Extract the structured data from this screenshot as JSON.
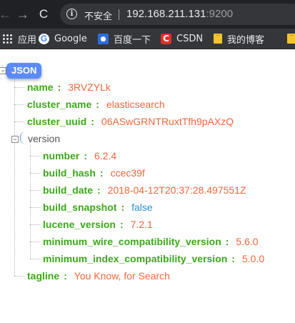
{
  "browser": {
    "security_label": "不安全",
    "url_host": "192.168.211.131",
    "url_port": ":9200"
  },
  "bookmarks": [
    {
      "label": "应用",
      "icon": "apps-icon"
    },
    {
      "label": "Google",
      "icon": "google-icon"
    },
    {
      "label": "百度一下",
      "icon": "baidu-icon"
    },
    {
      "label": "CSDN",
      "icon": "csdn-icon"
    },
    {
      "label": "我的博客",
      "icon": "folder-icon"
    }
  ],
  "icons": {
    "back": "←",
    "forward": "→",
    "reload": "C",
    "info": "i",
    "google_glyph": "G",
    "csdn_glyph": "C",
    "toggle_minus": "−"
  },
  "json_view": {
    "root_label": "JSON",
    "name": {
      "key": "name",
      "value": "3RVZYLk"
    },
    "cluster_name": {
      "key": "cluster_name",
      "value": "elasticsearch"
    },
    "cluster_uuid": {
      "key": "cluster_uuid",
      "value": "06ASwGRNTRuxtTfh9pAXzQ"
    },
    "version": {
      "key": "version",
      "number": {
        "key": "number",
        "value": "6.2.4"
      },
      "build_hash": {
        "key": "build_hash",
        "value": "ccec39f"
      },
      "build_date": {
        "key": "build_date",
        "value": "2018-04-12T20:37:28.497551Z"
      },
      "build_snapshot": {
        "key": "build_snapshot",
        "value": "false"
      },
      "lucene_version": {
        "key": "lucene_version",
        "value": "7.2.1"
      },
      "minimum_wire_compatibility_version": {
        "key": "minimum_wire_compatibility_version",
        "value": "5.6.0"
      },
      "minimum_index_compatibility_version": {
        "key": "minimum_index_compatibility_version",
        "value": "5.0.0"
      }
    },
    "tagline": {
      "key": "tagline",
      "value": "You Know, for Search"
    },
    "separator": ":"
  },
  "colors": {
    "key": "#3aa819",
    "string_value": "#f2673a",
    "boolean_value": "#2a8fd4",
    "root_pill": "#5b8bfa",
    "toolbar": "#202124"
  }
}
